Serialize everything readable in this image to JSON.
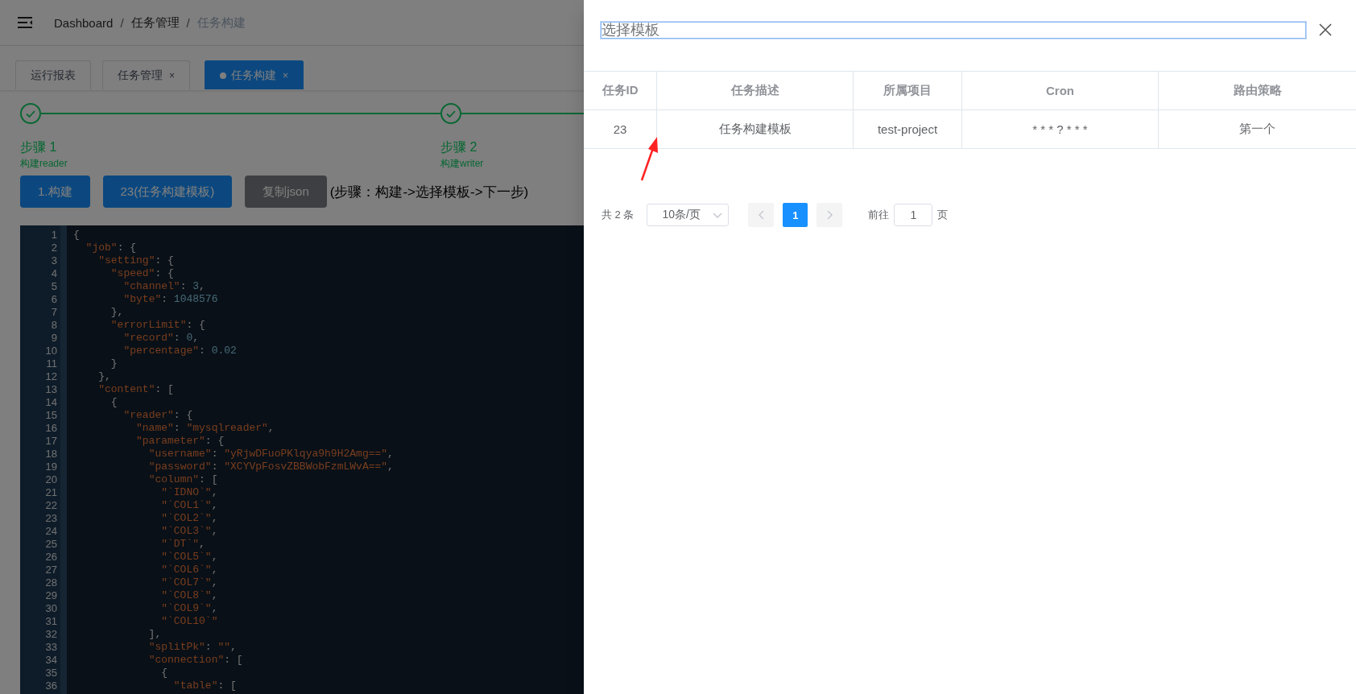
{
  "header": {
    "breadcrumb": [
      {
        "label": "Dashboard",
        "current": false
      },
      {
        "label": "任务管理",
        "current": false
      },
      {
        "label": "任务构建",
        "current": true
      }
    ],
    "separator": "/"
  },
  "tabs": [
    {
      "label": "运行报表",
      "closable": false,
      "selected": false
    },
    {
      "label": "任务管理",
      "closable": true,
      "close": "×",
      "selected": false
    },
    {
      "label": "任务构建",
      "closable": true,
      "close": "×",
      "selected": true
    }
  ],
  "steps": [
    {
      "title": "步骤 1",
      "description": "构建reader",
      "done": true
    },
    {
      "title": "步骤 2",
      "description": "构建writer",
      "done": true
    }
  ],
  "buttons": [
    {
      "label": "1.构建",
      "kind": "primary"
    },
    {
      "label": "23(任务构建模板)",
      "kind": "primary"
    },
    {
      "label": "复制json",
      "kind": "disabled"
    }
  ],
  "hint": "(步骤：构建->选择模板->下一步)",
  "editor": {
    "lines": [
      {
        "number": "1",
        "text": "{"
      },
      {
        "number": "2",
        "text": "  \"job\": {"
      },
      {
        "number": "3",
        "text": "    \"setting\": {"
      },
      {
        "number": "4",
        "text": "      \"speed\": {"
      },
      {
        "number": "5",
        "text": "        \"channel\": 3,"
      },
      {
        "number": "6",
        "text": "        \"byte\": 1048576"
      },
      {
        "number": "7",
        "text": "      },"
      },
      {
        "number": "8",
        "text": "      \"errorLimit\": {"
      },
      {
        "number": "9",
        "text": "        \"record\": 0,"
      },
      {
        "number": "10",
        "text": "        \"percentage\": 0.02"
      },
      {
        "number": "11",
        "text": "      }"
      },
      {
        "number": "12",
        "text": "    },"
      },
      {
        "number": "13",
        "text": "    \"content\": ["
      },
      {
        "number": "14",
        "text": "      {"
      },
      {
        "number": "15",
        "text": "        \"reader\": {"
      },
      {
        "number": "16",
        "text": "          \"name\": \"mysqlreader\","
      },
      {
        "number": "17",
        "text": "          \"parameter\": {"
      },
      {
        "number": "18",
        "text": "            \"username\": \"yRjwDFuoPKlqya9h9H2Amg==\","
      },
      {
        "number": "19",
        "text": "            \"password\": \"XCYVpFosvZBBWobFzmLWvA==\","
      },
      {
        "number": "20",
        "text": "            \"column\": ["
      },
      {
        "number": "21",
        "text": "              \"`IDNO`\","
      },
      {
        "number": "22",
        "text": "              \"`COL1`\","
      },
      {
        "number": "23",
        "text": "              \"`COL2`\","
      },
      {
        "number": "24",
        "text": "              \"`COL3`\","
      },
      {
        "number": "25",
        "text": "              \"`DT`\","
      },
      {
        "number": "26",
        "text": "              \"`COL5`\","
      },
      {
        "number": "27",
        "text": "              \"`COL6`\","
      },
      {
        "number": "28",
        "text": "              \"`COL7`\","
      },
      {
        "number": "29",
        "text": "              \"`COL8`\","
      },
      {
        "number": "30",
        "text": "              \"`COL9`\","
      },
      {
        "number": "31",
        "text": "              \"`COL10`\""
      },
      {
        "number": "32",
        "text": "            ],"
      },
      {
        "number": "33",
        "text": "            \"splitPk\": \"\","
      },
      {
        "number": "34",
        "text": "            \"connection\": ["
      },
      {
        "number": "35",
        "text": "              {"
      },
      {
        "number": "36",
        "text": "                \"table\": ["
      }
    ]
  },
  "drawer": {
    "title": "选择模板",
    "table": {
      "columns": [
        "任务ID",
        "任务描述",
        "所属项目",
        "Cron",
        "路由策略"
      ],
      "rows": [
        [
          "23",
          "任务构建模板",
          "test-project",
          "* * * ? * * *",
          "第一个"
        ]
      ]
    },
    "pagination": {
      "total": "共 2 条",
      "page_size": "10条/页",
      "pages": [
        {
          "label": "1",
          "selected": true
        }
      ],
      "jump_label": "前往",
      "jump_value": "1",
      "page_suffix": "页"
    }
  }
}
